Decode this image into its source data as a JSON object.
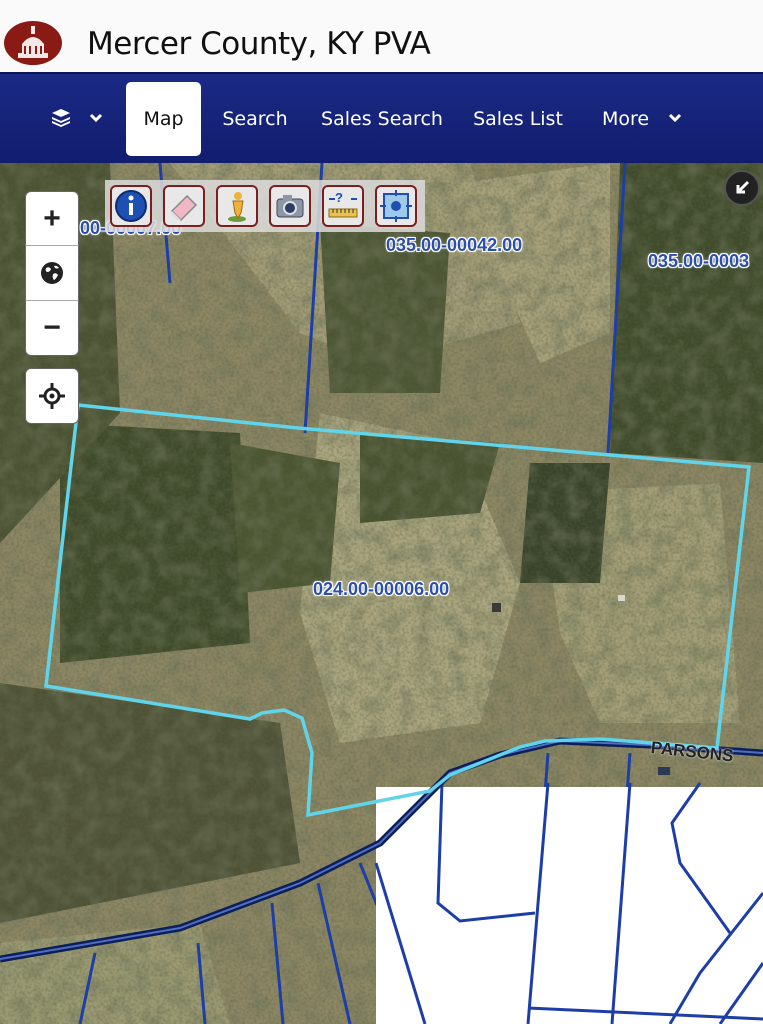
{
  "header": {
    "title": "Mercer County, KY PVA",
    "logo_icon": "courthouse-dome-icon"
  },
  "nav": {
    "layers_icon": "layers-icon",
    "layers_dropdown_icon": "chevron-down-icon",
    "items": [
      {
        "label": "Map",
        "active": true
      },
      {
        "label": "Search"
      },
      {
        "label": "Sales Search"
      },
      {
        "label": "Sales List"
      },
      {
        "label": "More",
        "icon": "chevron-down-icon"
      }
    ],
    "colors": {
      "bar": "#17237d",
      "active_bg": "#ffffff"
    }
  },
  "map": {
    "controls": {
      "zoom_in": "+",
      "globe_icon": "globe-icon",
      "zoom_out": "−",
      "locate_icon": "crosshair-icon"
    },
    "tools": [
      {
        "name": "info-icon"
      },
      {
        "name": "eraser-icon"
      },
      {
        "name": "streetview-pegman-icon"
      },
      {
        "name": "camera-icon"
      },
      {
        "name": "measure-icon"
      },
      {
        "name": "extent-icon"
      }
    ],
    "collapse_icon": "collapse-arrow-icon",
    "parcels": [
      {
        "label": "00-00007.00"
      },
      {
        "label": "035.00-00042.00"
      },
      {
        "label": "035.00-0003"
      },
      {
        "label": "024.00-00006.00"
      }
    ],
    "road_label": "PARSONS",
    "colors": {
      "selected_outline": "#5fd4ea",
      "parcel_lines": "#1d3ea6"
    }
  }
}
